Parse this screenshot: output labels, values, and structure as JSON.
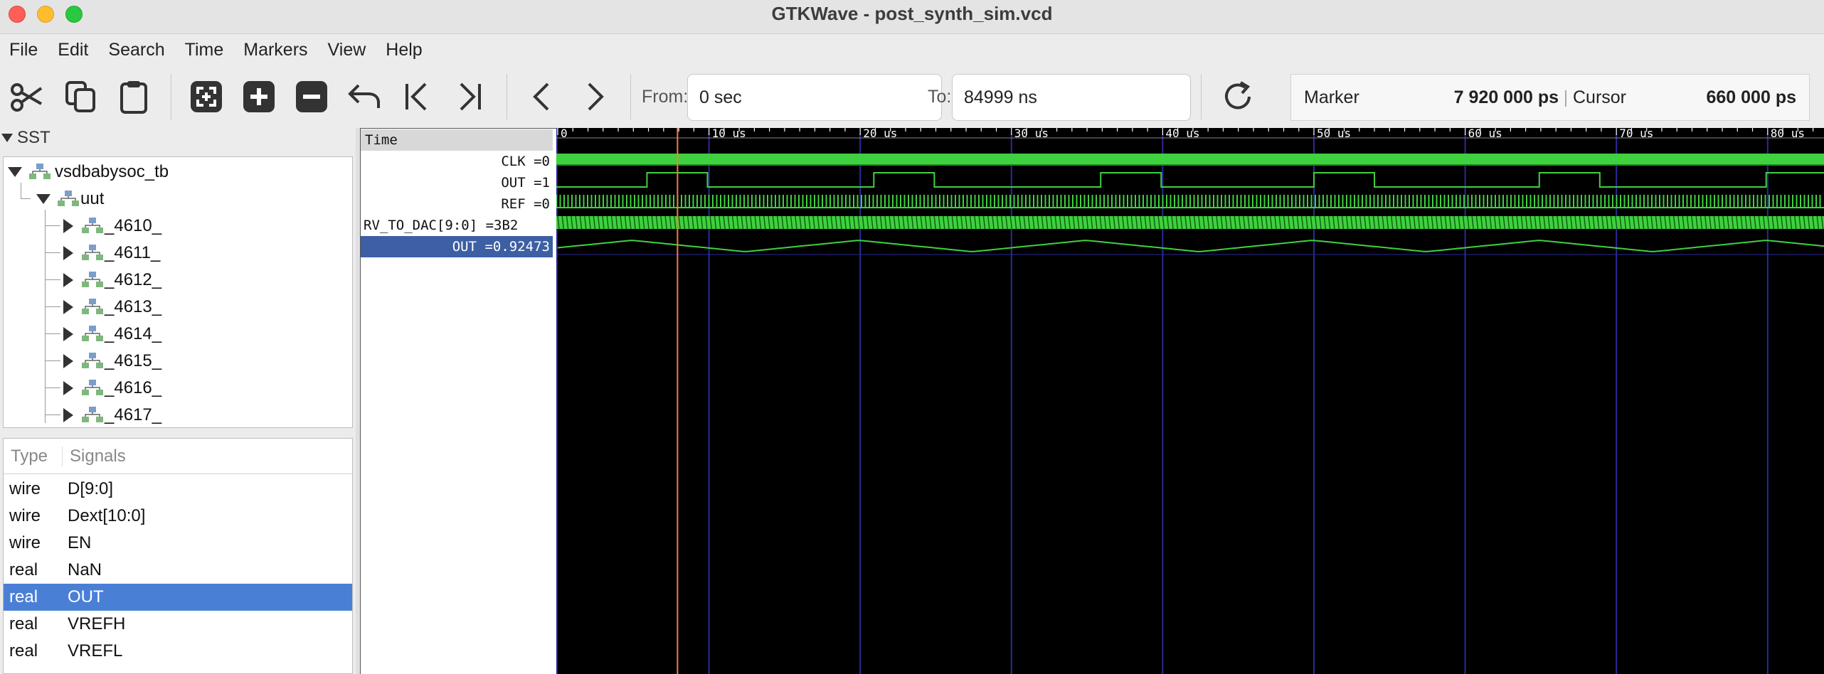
{
  "window": {
    "title": "GTKWave - post_synth_sim.vcd"
  },
  "menu": [
    "File",
    "Edit",
    "Search",
    "Time",
    "Markers",
    "View",
    "Help"
  ],
  "toolbar": {
    "buttons": [
      "cut-icon",
      "copy-icon",
      "paste-icon",
      "zoom-fit-icon",
      "zoom-in-icon",
      "zoom-out-icon",
      "undo-icon",
      "to-start-icon",
      "to-end-icon",
      "prev-icon",
      "next-icon",
      "reload-icon"
    ],
    "from_label": "From:",
    "from_value": "0 sec",
    "to_label": "To:",
    "to_value": "84999 ns",
    "marker_label": "Marker",
    "marker_value": "7 920 000 ps",
    "cursor_label": "Cursor",
    "cursor_value": "660 000 ps"
  },
  "sst": {
    "label": "SST",
    "root": "vsdbabysoc_tb",
    "child": "uut",
    "modules": [
      "_4610_",
      "_4611_",
      "_4612_",
      "_4613_",
      "_4614_",
      "_4615_",
      "_4616_",
      "_4617_"
    ]
  },
  "signals_panel": {
    "type_header": "Type",
    "signals_header": "Signals",
    "rows": [
      {
        "type": "wire",
        "name": "D[9:0]"
      },
      {
        "type": "wire",
        "name": "Dext[10:0]"
      },
      {
        "type": "wire",
        "name": "EN"
      },
      {
        "type": "real",
        "name": "NaN"
      },
      {
        "type": "real",
        "name": "OUT",
        "selected": true
      },
      {
        "type": "real",
        "name": "VREFH"
      },
      {
        "type": "real",
        "name": "VREFL"
      }
    ]
  },
  "wave_names": {
    "time_label": "Time",
    "rows": [
      {
        "label": "CLK =0"
      },
      {
        "label": "OUT =1"
      },
      {
        "label": "REF =0"
      },
      {
        "label": "RV_TO_DAC[9:0] =3B2"
      },
      {
        "label": "OUT =0.92473",
        "selected": true
      }
    ]
  },
  "timeline": {
    "ticks": [
      "0",
      "10 us",
      "20 us",
      "30 us",
      "40 us",
      "50 us",
      "60 us",
      "70 us",
      "80 us"
    ],
    "marker_us": 7.92,
    "range_us": 85
  },
  "colors": {
    "wave": "#3fd13f",
    "marker": "#ff7a3a",
    "grid": "#2a2a9a",
    "selection": "#4a7fd6"
  }
}
